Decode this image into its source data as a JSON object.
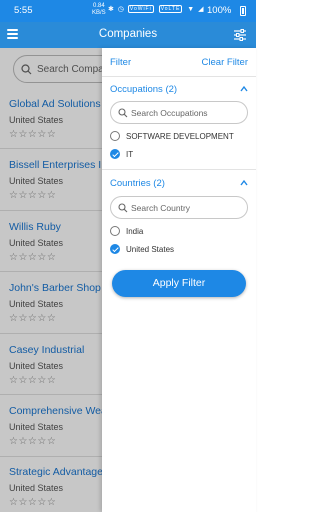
{
  "status_bar": {
    "time": "5:55",
    "network_speed": "0.84",
    "network_unit": "KB/S",
    "vpn_badge_1": "VoWiFi",
    "vpn_badge_2": "VoLTE",
    "battery": "100%"
  },
  "app_bar": {
    "title": "Companies",
    "menu_icon": "hamburger-menu-icon",
    "filter_icon": "sliders-icon"
  },
  "search": {
    "placeholder": "Search Companies"
  },
  "companies": [
    {
      "name": "Global Ad Solutions",
      "country": "United States",
      "rating": "☆☆☆☆☆"
    },
    {
      "name": "Bissell Enterprises Inc",
      "country": "United States",
      "rating": "☆☆☆☆☆"
    },
    {
      "name": "Willis Ruby",
      "country": "United States",
      "rating": "☆☆☆☆☆"
    },
    {
      "name": "John's Barber Shop",
      "country": "United States",
      "rating": "☆☆☆☆☆"
    },
    {
      "name": "Casey Industrial",
      "country": "United States",
      "rating": "☆☆☆☆☆"
    },
    {
      "name": "Comprehensive Wealth",
      "country": "United States",
      "rating": "☆☆☆☆☆"
    },
    {
      "name": "Strategic Advantage",
      "country": "United States",
      "rating": "☆☆☆☆☆"
    }
  ],
  "filter_panel": {
    "header": "Filter",
    "clear": "Clear Filter",
    "occupations": {
      "title": "Occupations (2)",
      "search_placeholder": "Search Occupations",
      "options": [
        {
          "label": "SOFTWARE DEVELOPMENT",
          "selected": false
        },
        {
          "label": "IT",
          "selected": true
        }
      ]
    },
    "countries": {
      "title": "Countries (2)",
      "search_placeholder": "Search Country",
      "options": [
        {
          "label": "India",
          "selected": false
        },
        {
          "label": "United States",
          "selected": true
        }
      ]
    },
    "apply_label": "Apply Filter"
  },
  "colors": {
    "primary": "#1e88e5",
    "link": "#1976d2"
  }
}
